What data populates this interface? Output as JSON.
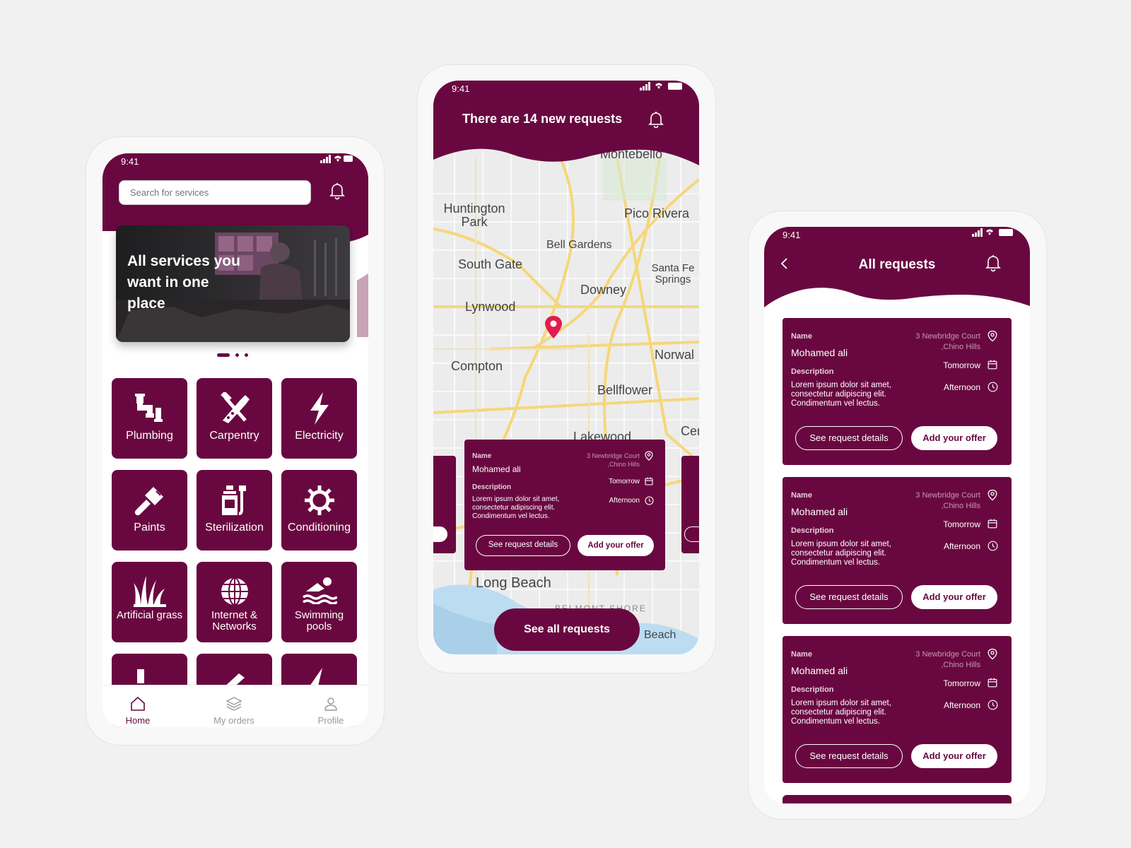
{
  "colors": {
    "brand": "#690840",
    "background": "#f1f1f2",
    "white": "#ffffff",
    "map_road": "#f5d77a",
    "pin": "#e21c4c",
    "water": "#bcdcf2"
  },
  "phone1": {
    "status_time": "9:41",
    "search_placeholder": "Search for services",
    "banner_text": "All services you want in one place",
    "icons": {
      "bell": "bell-icon"
    },
    "services": [
      {
        "label": "Plumbing",
        "icon": "pipe-icon"
      },
      {
        "label": "Carpentry",
        "icon": "saw-hammer-icon"
      },
      {
        "label": "Electricity",
        "icon": "lightning-icon"
      },
      {
        "label": "Paints",
        "icon": "paintbrush-icon"
      },
      {
        "label": "Sterilization",
        "icon": "spray-bottle-icon"
      },
      {
        "label": "Conditioning",
        "icon": "snowflake-icon"
      },
      {
        "label": "Artificial grass",
        "icon": "grass-icon"
      },
      {
        "label": "Internet & Networks",
        "icon": "globe-icon"
      },
      {
        "label": "Swimming pools",
        "icon": "swimmer-icon"
      }
    ],
    "nav": [
      {
        "label": "Home",
        "icon": "home-icon"
      },
      {
        "label": "My orders",
        "icon": "layers-icon"
      },
      {
        "label": "Profile",
        "icon": "user-icon"
      }
    ]
  },
  "phone2": {
    "status_time": "9:41",
    "header_title": "There are 14 new requests",
    "map_labels": [
      "Montebello",
      "Huntington Park",
      "Pico Rivera",
      "Bell Gardens",
      "South Gate",
      "Santa Fe Springs",
      "Downey",
      "Lynwood",
      "Norwal",
      "Compton",
      "Bellflower",
      "Lakewood",
      "Cer",
      "Long Beach",
      "BELMONT SHORE",
      "Beach"
    ],
    "card": {
      "name_label": "Name",
      "name": "Mohamed ali",
      "address": "3 Newbridge Court ,Chino Hills",
      "date": "Tomorrow",
      "time": "Afternoon",
      "description_label": "Description",
      "description": "Lorem ipsum dolor sit amet, consectetur adipiscing elit. Condimentum vel lectus.",
      "details_button": "See request details",
      "offer_button": "Add your offer"
    },
    "see_all_button": "See all requests"
  },
  "phone3": {
    "status_time": "9:41",
    "header_title": "All requests",
    "cards": [
      {
        "name_label": "Name",
        "name": "Mohamed ali",
        "address": "3 Newbridge Court ,Chino Hills",
        "date": "Tomorrow",
        "time": "Afternoon",
        "description_label": "Description",
        "description": "Lorem ipsum dolor sit amet, consectetur adipiscing elit. Condimentum vel lectus.",
        "details_button": "See request details",
        "offer_button": "Add your offer"
      },
      {
        "name_label": "Name",
        "name": "Mohamed ali",
        "address": "3 Newbridge Court ,Chino Hills",
        "date": "Tomorrow",
        "time": "Afternoon",
        "description_label": "Description",
        "description": "Lorem ipsum dolor sit amet, consectetur adipiscing elit. Condimentum vel lectus.",
        "details_button": "See request details",
        "offer_button": "Add your offer"
      },
      {
        "name_label": "Name",
        "name": "Mohamed ali",
        "address": "3 Newbridge Court ,Chino Hills",
        "date": "Tomorrow",
        "time": "Afternoon",
        "description_label": "Description",
        "description": "Lorem ipsum dolor sit amet, consectetur adipiscing elit. Condimentum vel lectus.",
        "details_button": "See request details",
        "offer_button": "Add your offer"
      }
    ]
  }
}
